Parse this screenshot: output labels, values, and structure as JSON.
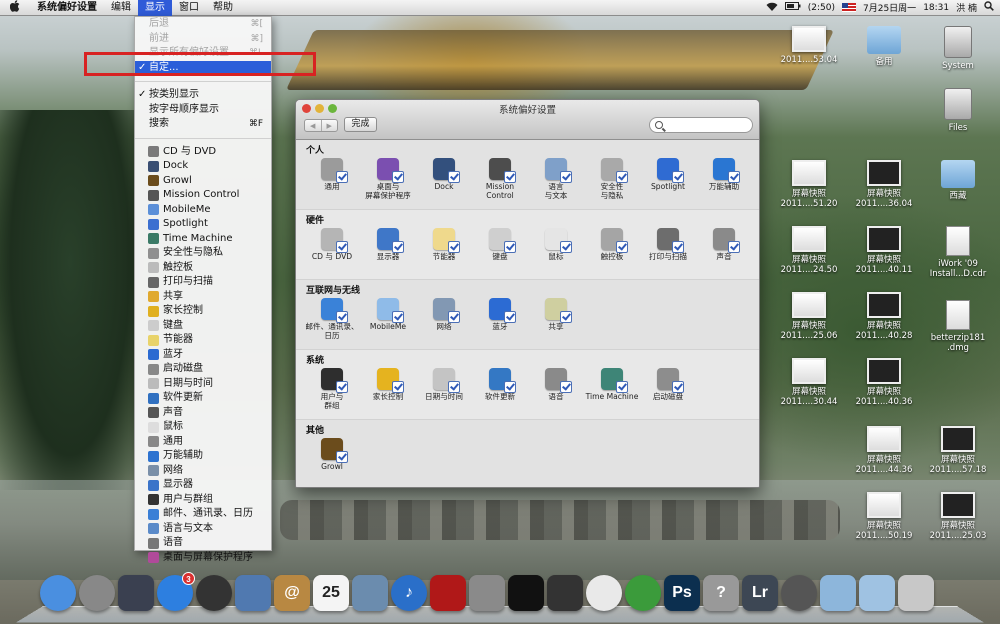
{
  "menubar": {
    "apple": "",
    "app": "系统偏好设置",
    "menus": [
      "编辑",
      "显示",
      "窗口",
      "帮助"
    ],
    "status": {
      "battery": "(2:50)",
      "datetime": "7月25日周一",
      "time": "18:31",
      "user": "洪 楠"
    }
  },
  "dropdown": {
    "items": [
      {
        "label": "后退",
        "shortcut": "⌘[",
        "disabled": true
      },
      {
        "label": "前进",
        "shortcut": "⌘]",
        "disabled": true
      },
      {
        "label": "显示所有偏好设置",
        "shortcut": "⌘L",
        "disabled": true
      },
      {
        "label": "自定...",
        "shortcut": "",
        "selected": true,
        "check": "✓"
      }
    ],
    "sort_items": [
      {
        "label": "按类别显示",
        "check": "✓"
      },
      {
        "label": "按字母顺序显示",
        "check": ""
      },
      {
        "label": "搜索",
        "shortcut": "⌘F"
      }
    ],
    "panes": [
      "CD 与 DVD",
      "Dock",
      "Growl",
      "Mission Control",
      "MobileMe",
      "Spotlight",
      "Time Machine",
      "安全性与隐私",
      "触控板",
      "打印与扫描",
      "共享",
      "家长控制",
      "键盘",
      "节能器",
      "蓝牙",
      "启动磁盘",
      "日期与时间",
      "软件更新",
      "声音",
      "鼠标",
      "通用",
      "万能辅助",
      "网络",
      "显示器",
      "用户与群组",
      "邮件、通讯录、日历",
      "语言与文本",
      "语音",
      "桌面与屏幕保护程序"
    ],
    "pane_colors": [
      "#7a7a7a",
      "#3a4f73",
      "#6b4c1c",
      "#555",
      "#5b8fd8",
      "#3b6fd0",
      "#3a7a66",
      "#8f8f8f",
      "#bbb",
      "#666",
      "#e0a92f",
      "#e0b020",
      "#ccc",
      "#e8d36a",
      "#2b6ad1",
      "#888",
      "#bbb",
      "#3070c0",
      "#555",
      "#ddd",
      "#888",
      "#2d73d0",
      "#7a8fa8",
      "#3b74c9",
      "#333",
      "#3a7fd6",
      "#5a8ac9",
      "#777",
      "#b04a9a"
    ]
  },
  "window": {
    "title": "系统偏好设置",
    "done": "完成",
    "sections": [
      {
        "title": "个人",
        "items": [
          {
            "label": "通用",
            "color": "#9b9b9b"
          },
          {
            "label": "桌面与\n屏幕保护程序",
            "color": "#7b4fb0"
          },
          {
            "label": "Dock",
            "color": "#33507d"
          },
          {
            "label": "Mission\nControl",
            "color": "#4d4d4d"
          },
          {
            "label": "语言\n与文本",
            "color": "#7fa0c9"
          },
          {
            "label": "安全性\n与隐私",
            "color": "#a9a9a9"
          },
          {
            "label": "Spotlight",
            "color": "#2f6bd2"
          },
          {
            "label": "万能辅助",
            "color": "#2a76d2"
          }
        ]
      },
      {
        "title": "硬件",
        "items": [
          {
            "label": "CD 与 DVD",
            "color": "#b5b5b5"
          },
          {
            "label": "显示器",
            "color": "#3f77c8"
          },
          {
            "label": "节能器",
            "color": "#efd98c"
          },
          {
            "label": "键盘",
            "color": "#cfcfcf"
          },
          {
            "label": "鼠标",
            "color": "#e5e5e5"
          },
          {
            "label": "触控板",
            "color": "#a5a5a5"
          },
          {
            "label": "打印与扫描",
            "color": "#6d6d6d"
          },
          {
            "label": "声音",
            "color": "#8a8a8a"
          }
        ]
      },
      {
        "title": "互联网与无线",
        "items": [
          {
            "label": "邮件、通讯录、\n日历",
            "color": "#3a82d8"
          },
          {
            "label": "MobileMe",
            "color": "#8fbbe8"
          },
          {
            "label": "网络",
            "color": "#8298b3"
          },
          {
            "label": "蓝牙",
            "color": "#2c6bd3"
          },
          {
            "label": "共享",
            "color": "#cfcfa0"
          }
        ]
      },
      {
        "title": "系统",
        "items": [
          {
            "label": "用户与\n群组",
            "color": "#2e2e2e"
          },
          {
            "label": "家长控制",
            "color": "#e5b31f"
          },
          {
            "label": "日期与时间",
            "color": "#c4c4c4"
          },
          {
            "label": "软件更新",
            "color": "#3478c4"
          },
          {
            "label": "语音",
            "color": "#8a8a8a"
          },
          {
            "label": "Time Machine",
            "color": "#3e8577"
          },
          {
            "label": "启动磁盘",
            "color": "#8d8d8d"
          }
        ]
      },
      {
        "title": "其他",
        "items": [
          {
            "label": "Growl",
            "color": "#6b4c1c"
          }
        ]
      }
    ]
  },
  "desktop": [
    {
      "label": "2011....53.04",
      "kind": "thumb-light"
    },
    {
      "label": "备用",
      "kind": "folder"
    },
    {
      "label": "System",
      "kind": "disk"
    },
    {
      "label": "Files",
      "kind": "disk"
    },
    {
      "label": "屏幕快照\n2011....51.20",
      "kind": "thumb-light"
    },
    {
      "label": "屏幕快照\n2011....36.04",
      "kind": "thumb"
    },
    {
      "label": "西藏",
      "kind": "folder"
    },
    {
      "label": "屏幕快照\n2011....24.50",
      "kind": "thumb-light"
    },
    {
      "label": "屏幕快照\n2011....40.11",
      "kind": "thumb"
    },
    {
      "label": "iWork '09\nInstall...D.cdr",
      "kind": "doc"
    },
    {
      "label": "屏幕快照\n2011....25.06",
      "kind": "thumb-light"
    },
    {
      "label": "屏幕快照\n2011....40.28",
      "kind": "thumb"
    },
    {
      "label": "betterzip181\n.dmg",
      "kind": "doc"
    },
    {
      "label": "屏幕快照\n2011....30.44",
      "kind": "thumb-light"
    },
    {
      "label": "屏幕快照\n2011....40.36",
      "kind": "thumb"
    },
    {
      "label": "屏幕快照\n2011....44.36",
      "kind": "thumb-light"
    },
    {
      "label": "屏幕快照\n2011....57.18",
      "kind": "thumb"
    },
    {
      "label": "屏幕快照\n2011....50.19",
      "kind": "thumb-light"
    },
    {
      "label": "屏幕快照\n2011....25.03",
      "kind": "thumb"
    }
  ],
  "dock": {
    "items": [
      {
        "name": "finder",
        "color": "#4a8fe0",
        "text": ""
      },
      {
        "name": "launchpad",
        "color": "#888",
        "text": ""
      },
      {
        "name": "mission-control",
        "color": "#3a4050",
        "text": ""
      },
      {
        "name": "app-store",
        "color": "#2d7fe0",
        "text": "",
        "badge": "3"
      },
      {
        "name": "dashboard",
        "color": "#333",
        "text": ""
      },
      {
        "name": "mail",
        "color": "#5079b0",
        "text": ""
      },
      {
        "name": "address-book",
        "color": "#b88842",
        "text": "@"
      },
      {
        "name": "ical",
        "color": "#f4f4f4",
        "text": "25"
      },
      {
        "name": "preview",
        "color": "#6b8cae",
        "text": ""
      },
      {
        "name": "itunes",
        "color": "#2a6fc9",
        "text": "♪"
      },
      {
        "name": "photo-booth",
        "color": "#b01818",
        "text": ""
      },
      {
        "name": "system-preferences",
        "color": "#8a8a8a",
        "text": ""
      },
      {
        "name": "qq",
        "color": "#111",
        "text": ""
      },
      {
        "name": "dvd-player",
        "color": "#333",
        "text": ""
      },
      {
        "name": "picasa",
        "color": "#e9e9e9",
        "text": ""
      },
      {
        "name": "chrome",
        "color": "#3b9b3b",
        "text": ""
      },
      {
        "name": "photoshop",
        "color": "#0c2f4f",
        "text": "Ps"
      },
      {
        "name": "help",
        "color": "#999",
        "text": "?"
      },
      {
        "name": "lightroom",
        "color": "#3d4754",
        "text": "Lr"
      },
      {
        "name": "facetime",
        "color": "#555",
        "text": ""
      },
      {
        "name": "applications-stack",
        "color": "#8db6db",
        "text": ""
      },
      {
        "name": "documents-stack",
        "color": "#9fc2e2",
        "text": ""
      },
      {
        "name": "trash",
        "color": "#c8c8c8",
        "text": ""
      }
    ]
  }
}
